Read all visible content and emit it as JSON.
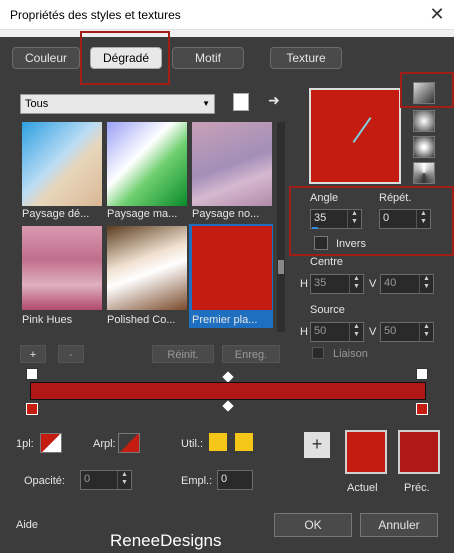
{
  "window": {
    "title": "Propriétés des styles et textures",
    "close_icon": "close-icon"
  },
  "tabs": [
    {
      "label": "Couleur"
    },
    {
      "label": "Dégradé"
    },
    {
      "label": "Motif"
    },
    {
      "label": "Texture"
    }
  ],
  "toolbar": {
    "category": "Tous"
  },
  "gradients": [
    {
      "name": "Paysage dé...",
      "colors": [
        "#2d9fe0",
        "#b9dcf5",
        "#e8d6bb",
        "#d9b795"
      ]
    },
    {
      "name": "Paysage ma...",
      "colors": [
        "#9aa0f5",
        "#ffffff",
        "#6fd06f",
        "#0a8a2c"
      ]
    },
    {
      "name": "Paysage no...",
      "colors": [
        "#c9a0b8",
        "#a38fb8",
        "#d6b8d0",
        "#b08aa8"
      ]
    },
    {
      "name": "Pink Hues",
      "colors": [
        "#d89ab0",
        "#c06e8c",
        "#e0b0c0",
        "#b04a6a"
      ]
    },
    {
      "name": "Polished Co...",
      "colors": [
        "#5a3c1e",
        "#f0e0d0",
        "#ffffff",
        "#7a4a2a"
      ]
    },
    {
      "name": "Premier pla...",
      "colors": [
        "#c41c10",
        "#b01010",
        "#c41c10",
        "#a81515"
      ]
    }
  ],
  "buttons": {
    "reinit": "Réinit.",
    "enreg": "Enreg.",
    "plus": "+",
    "minus": "-",
    "ok": "OK",
    "cancel": "Annuler",
    "help": "Aide"
  },
  "angle": {
    "label": "Angle",
    "value": "35"
  },
  "repet": {
    "label": "Répét.",
    "value": "0"
  },
  "invers": {
    "label": "Invers"
  },
  "centre": {
    "label": "Centre",
    "h_label": "H",
    "h": "35",
    "v_label": "V",
    "v": "40"
  },
  "source": {
    "label": "Source",
    "h_label": "H",
    "h": "50",
    "v_label": "V",
    "v": "50"
  },
  "liaison": {
    "label": "Liaison"
  },
  "bottom": {
    "ipl": "1pl:",
    "arpl": "Arpl:",
    "util": "Util.:",
    "opacite": "Opacité:",
    "opacite_value": "0",
    "empl": "Empl.:",
    "empl_value": "0",
    "actuel": "Actuel",
    "prec": "Préc."
  },
  "colors": {
    "primary_red": "#c41c10",
    "dark_red": "#b01818",
    "util_swatch": "#f5c518",
    "accent_red_box": "#a11d17"
  },
  "watermark": "ReneeDesigns"
}
